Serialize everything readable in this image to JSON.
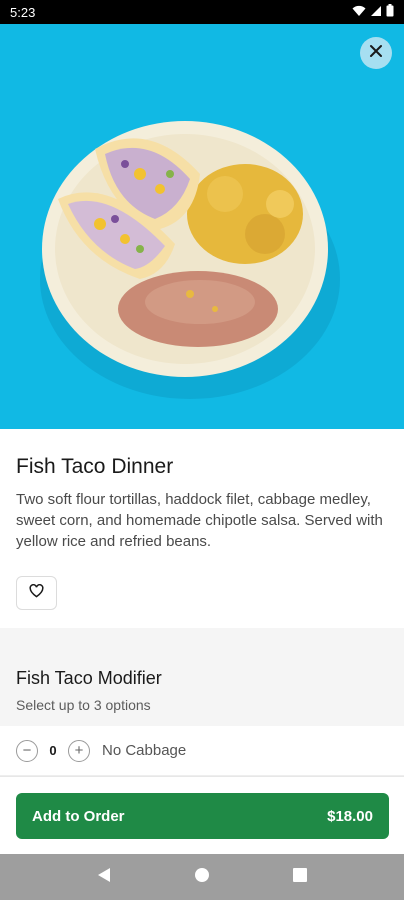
{
  "status_bar": {
    "time": "5:23",
    "icons": [
      "wifi-icon",
      "signal-icon",
      "battery-icon"
    ]
  },
  "hero": {
    "image_subject": "fish tacos with yellow rice and refried beans on a cream plate, blue background",
    "background_color": "#11b9e4",
    "close_icon": "close-icon"
  },
  "item": {
    "title": "Fish Taco Dinner",
    "description": "Two soft flour tortillas, haddock filet, cabbage medley, sweet corn, and homemade chipotle salsa. Served with yellow rice and refried beans.",
    "favorite_icon": "heart-icon"
  },
  "modifier": {
    "title": "Fish Taco Modifier",
    "subtitle": "Select up to 3 options",
    "options": [
      {
        "decrement": "−",
        "quantity": "0",
        "increment": "+",
        "label": "No Cabbage"
      }
    ]
  },
  "order": {
    "button_label": "Add to Order",
    "price": "$18.00",
    "accent_color": "#1f8a46"
  },
  "nav_bar": {
    "icons": [
      "back-icon",
      "home-icon",
      "recents-icon"
    ]
  }
}
